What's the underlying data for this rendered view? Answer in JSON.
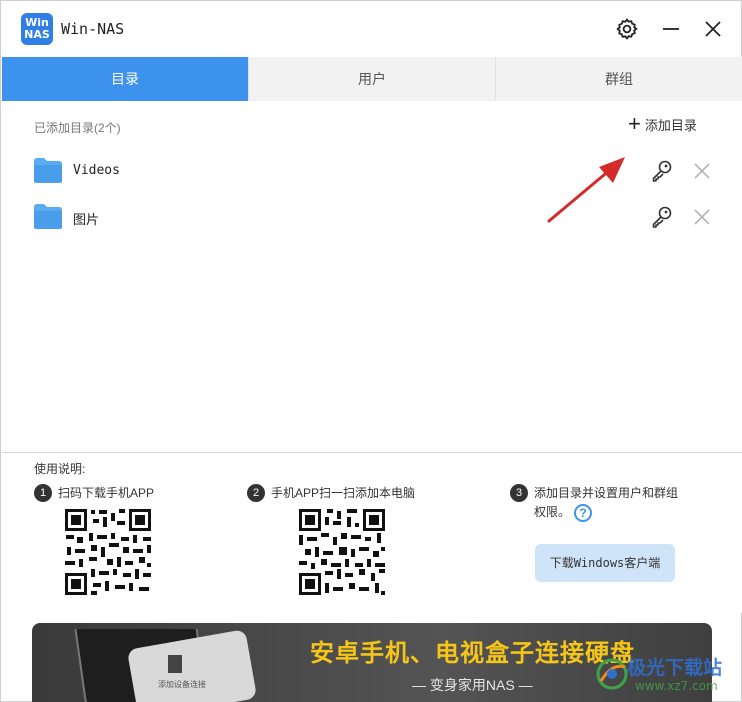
{
  "app": {
    "logo_line1": "Win",
    "logo_line2": "NAS",
    "title": "Win-NAS"
  },
  "titlebar": {
    "settings_icon": "gear-icon",
    "minimize_icon": "minimize-icon",
    "close_icon": "close-icon"
  },
  "tabs": [
    {
      "label": "目录",
      "active": true
    },
    {
      "label": "用户",
      "active": false
    },
    {
      "label": "群组",
      "active": false
    }
  ],
  "directories": {
    "count_label": "已添加目录(2个)",
    "add_label": "添加目录",
    "items": [
      {
        "name": "Videos",
        "icon": "folder-icon"
      },
      {
        "name": "图片",
        "icon": "folder-icon"
      }
    ]
  },
  "instructions": {
    "title": "使用说明:",
    "steps": [
      {
        "num": "1",
        "text": "扫码下载手机APP"
      },
      {
        "num": "2",
        "text": "手机APP扫一扫添加本电脑"
      },
      {
        "num": "3",
        "text": "添加目录并设置用户和群组权限。"
      }
    ],
    "download_button": "下载Windows客户端"
  },
  "banner": {
    "title": "安卓手机、电视盒子连接硬盘",
    "subtitle": "— 变身家用NAS —",
    "phone_caption": "添加设备连接"
  },
  "watermark": {
    "text": "极光下载站",
    "url": "www.xz7.com"
  },
  "colors": {
    "accent": "#3d92ee",
    "banner_title": "#f5c518",
    "annotation_arrow": "#d42a2a"
  }
}
